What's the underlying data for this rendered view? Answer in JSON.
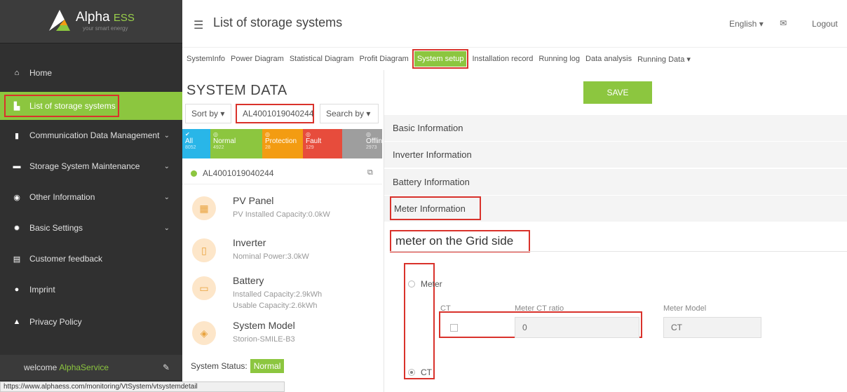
{
  "brand": {
    "name": "Alpha",
    "suffix": "ESS",
    "tagline": "your smart energy"
  },
  "sidebar": {
    "items": [
      {
        "label": "Home",
        "icon": "home-icon"
      },
      {
        "label": "List of storage systems",
        "icon": "sitemap-icon",
        "active": true
      },
      {
        "label": "Communication Data Management",
        "icon": "document-icon"
      },
      {
        "label": "Storage System Maintenance",
        "icon": "card-icon"
      },
      {
        "label": "Other Information",
        "icon": "eye-icon"
      },
      {
        "label": "Basic Settings",
        "icon": "gear-icon"
      },
      {
        "label": "Customer feedback",
        "icon": "list-icon"
      },
      {
        "label": "Imprint",
        "icon": "info-icon"
      },
      {
        "label": "Privacy Policy",
        "icon": "lock-icon"
      }
    ],
    "welcome_text": "welcome",
    "welcome_user": "AlphaService"
  },
  "header": {
    "title": "List of storage systems",
    "language": "English",
    "logout": "Logout"
  },
  "tabs": [
    "SystemInfo",
    "Power Diagram",
    "Statistical Diagram",
    "Profit Diagram",
    "System setup",
    "Installation record",
    "Running log",
    "Data analysis",
    "Running Data"
  ],
  "system_data": {
    "title": "SYSTEM DATA",
    "sort_by": "Sort by",
    "search_value": "AL4001019040244",
    "search_by": "Search by",
    "statuses": [
      {
        "label": "All",
        "count": "8052",
        "color": "#29b6e8"
      },
      {
        "label": "Normal",
        "count": "4922",
        "color": "#8cc63f"
      },
      {
        "label": "Protection",
        "count": "28",
        "color": "#f39c12"
      },
      {
        "label": "Fault",
        "count": "129",
        "color": "#e74c3c"
      },
      {
        "label": "Offline",
        "count": "2973",
        "color": "#9e9e9e"
      }
    ],
    "system_id": "AL4001019040244",
    "components": [
      {
        "name": "PV Panel",
        "details": [
          "PV Installed Capacity:0.0kW"
        ]
      },
      {
        "name": "Inverter",
        "details": [
          "Nominal Power:3.0kW"
        ]
      },
      {
        "name": "Battery",
        "details": [
          "Installed Capacity:2.9kWh",
          "Usable Capacity:2.6kWh"
        ]
      },
      {
        "name": "System Model",
        "details": [
          "Storion-SMILE-B3"
        ]
      }
    ],
    "status_label": "System Status:",
    "status_value": "Normal"
  },
  "setup": {
    "save_label": "SAVE",
    "sections": [
      "Basic Information",
      "Inverter Information",
      "Battery Information",
      "Meter Information"
    ],
    "grid_title": "meter on the Grid side",
    "meter_option": "Meter",
    "ct_option": "CT",
    "ct_label": "CT",
    "ratio_label": "Meter CT ratio",
    "ratio_value": "0",
    "model_label": "Meter Model",
    "model_value": "CT"
  },
  "status_url": "https://www.alphaess.com/monitoring/VtSystem/vtsystemdetail"
}
